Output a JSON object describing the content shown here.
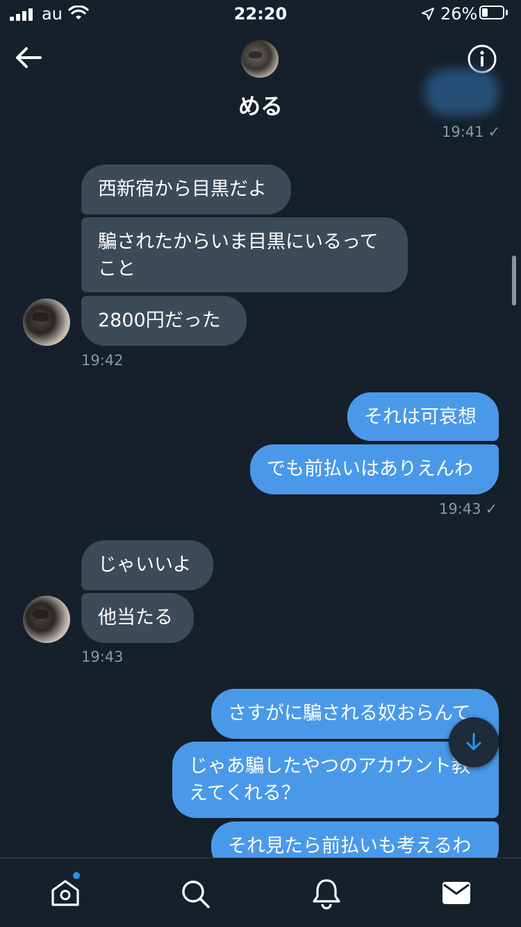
{
  "status_bar": {
    "carrier": "au",
    "time": "22:20",
    "battery": "26%"
  },
  "header": {
    "title": "める"
  },
  "messages": {
    "prev_time": "19:41",
    "group1": [
      "西新宿から目黒だよ",
      "騙されたからいま目黒にいるって",
      "こと",
      "2800円だった"
    ],
    "group1_time": "19:42",
    "group2": [
      "それは可哀想",
      "でも前払いはありえんわ"
    ],
    "group2_time": "19:43",
    "group3": [
      "じゃいいよ",
      "他当たる"
    ],
    "group3_time": "19:43",
    "group4": [
      "さすがに騙される奴おらんて",
      "じゃあ騙したやつのアカウント教",
      "えてくれる？",
      "それ見たら前払いも考えるわ"
    ]
  },
  "colors": {
    "background": "#15202b",
    "received": "#3d4a58",
    "sent": "#4a99e9",
    "accent": "#1d9bf0"
  },
  "tabs": [
    "home-icon",
    "search-icon",
    "notifications-icon",
    "messages-icon"
  ]
}
